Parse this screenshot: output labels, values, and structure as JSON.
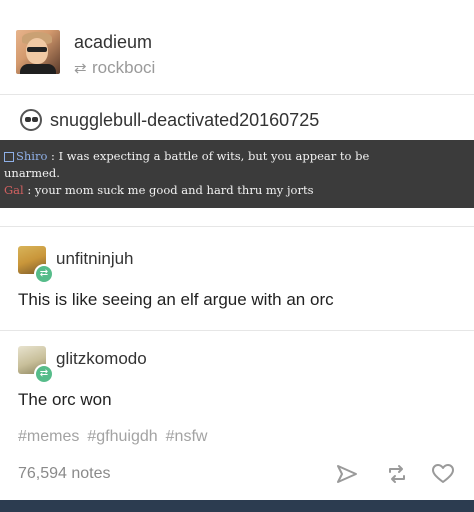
{
  "post": {
    "author": "acadieum",
    "reblogged_from": "rockboci",
    "source": "snugglebull-deactivated20160725",
    "chat": [
      {
        "speaker": "Shiro",
        "sep": ":",
        "text": "I was expecting a battle of wits, but you appear to be"
      },
      {
        "speaker": "",
        "sep": "",
        "text": "unarmed."
      },
      {
        "speaker": "Gal",
        "sep": ":",
        "text": "your mom suck me good and hard thru my jorts"
      }
    ],
    "reblogs": [
      {
        "user": "unfitninjuh",
        "text": "This is like seeing an elf argue with an orc"
      },
      {
        "user": "glitzkomodo",
        "text": "The orc won"
      }
    ],
    "tags": [
      "#memes",
      "#gfhuigdh",
      "#nsfw"
    ],
    "notes": "76,594 notes"
  },
  "icons": {
    "reblog": "reblog-icon",
    "share": "paper-plane-icon",
    "like": "heart-icon"
  },
  "colors": {
    "frame": "#2c3c50",
    "reblog_badge": "#56bc8a",
    "chat_bg": "#3b3b3b",
    "shiro_name": "#8fb0e8",
    "gal_name": "#d06060"
  }
}
